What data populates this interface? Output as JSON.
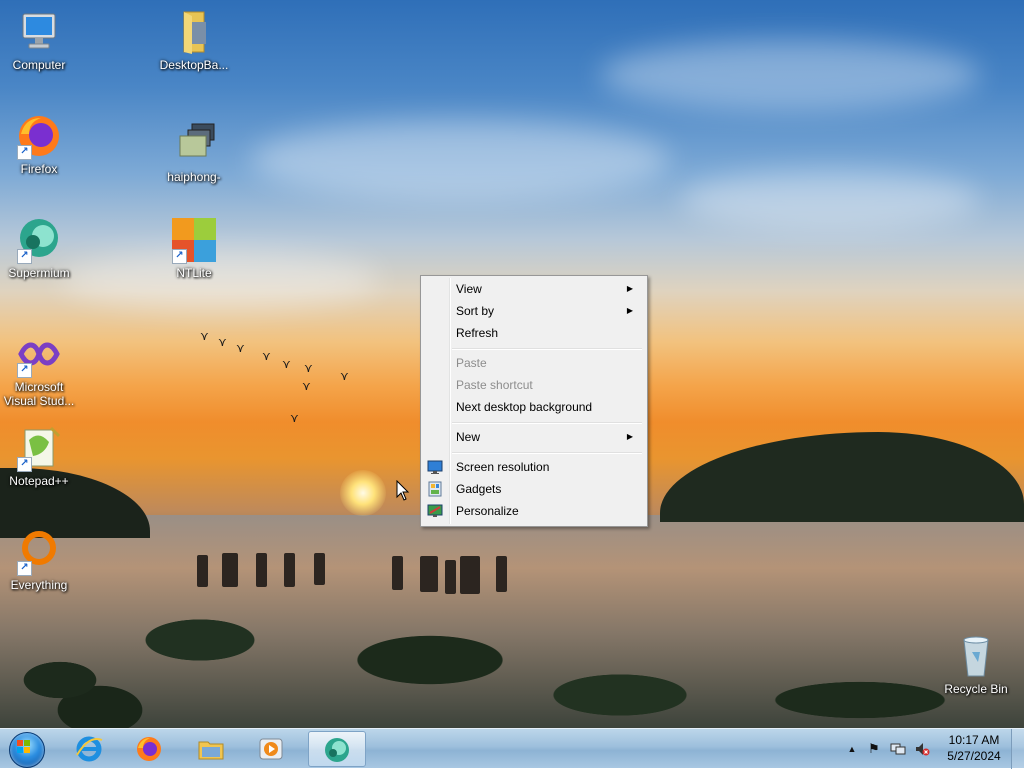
{
  "desktop": {
    "icons": [
      {
        "label": "Computer"
      },
      {
        "label": "DesktopBa..."
      },
      {
        "label": "Firefox"
      },
      {
        "label": "haiphong-"
      },
      {
        "label": "Supermium"
      },
      {
        "label": "NTLite"
      },
      {
        "label": "Microsoft\nVisual Stud..."
      },
      {
        "label": "Notepad++"
      },
      {
        "label": "Everything"
      },
      {
        "label": "Recycle Bin"
      }
    ]
  },
  "context_menu": {
    "items": [
      {
        "label": "View",
        "submenu": true,
        "enabled": true
      },
      {
        "label": "Sort by",
        "submenu": true,
        "enabled": true
      },
      {
        "label": "Refresh",
        "submenu": false,
        "enabled": true
      },
      {
        "label": "Paste",
        "submenu": false,
        "enabled": false
      },
      {
        "label": "Paste shortcut",
        "submenu": false,
        "enabled": false
      },
      {
        "label": "Next desktop background",
        "submenu": false,
        "enabled": true
      },
      {
        "label": "New",
        "submenu": true,
        "enabled": true
      },
      {
        "label": "Screen resolution",
        "submenu": false,
        "enabled": true,
        "icon": "monitor-icon"
      },
      {
        "label": "Gadgets",
        "submenu": false,
        "enabled": true,
        "icon": "gadgets-icon"
      },
      {
        "label": "Personalize",
        "submenu": false,
        "enabled": true,
        "icon": "personalize-icon"
      }
    ],
    "submenu_glyph": "▶"
  },
  "taskbar": {
    "pinned": [
      {
        "name": "internet-explorer-icon"
      },
      {
        "name": "firefox-icon"
      },
      {
        "name": "file-explorer-icon"
      },
      {
        "name": "media-player-icon"
      },
      {
        "name": "supermium-icon",
        "active": true
      }
    ],
    "tray": {
      "show_hidden_glyph": "▲",
      "flag_glyph": "⚑",
      "clock_time": "10:17 AM",
      "clock_date": "5/27/2024"
    }
  },
  "colors": {
    "menu_bg": "#f0f0f0",
    "menu_disabled": "#8d8d8d",
    "taskbar": "#9dbfdc"
  }
}
